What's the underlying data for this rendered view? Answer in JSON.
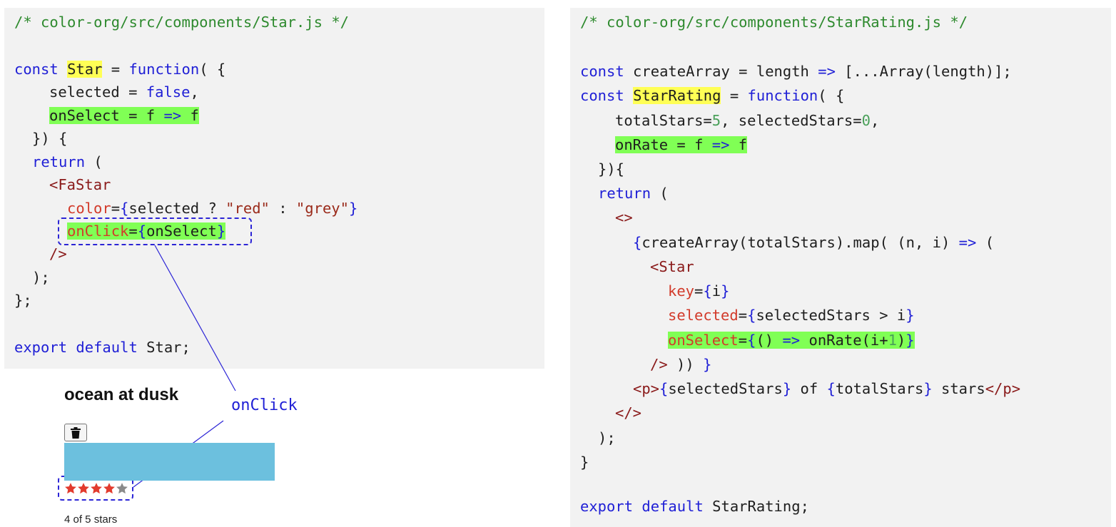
{
  "left_code": {
    "comment": "/* color-org/src/components/Star.js */",
    "l1": {
      "kw1": "const",
      "name": "Star",
      "eq": " = ",
      "kw2": "function",
      "rest": "( {"
    },
    "l2": {
      "name": "selected = ",
      "val": "false",
      "comma": ","
    },
    "l3": {
      "a": "onSelect = f ",
      "arrow": "=>",
      "b": " f"
    },
    "l4": "}) {",
    "l5": "return",
    "l5b": " (",
    "l6": "<FaStar",
    "l7": {
      "attr": "color",
      "eq": "=",
      "ob": "{",
      "expr": "selected ? ",
      "s1": "\"red\"",
      "colon": " : ",
      "s2": "\"grey\"",
      "cb": "}"
    },
    "l8": {
      "attr": "onClick",
      "eq": "=",
      "ob": "{",
      "expr": "onSelect",
      "cb": "}"
    },
    "l9": "/>",
    "l10": ");",
    "l11": "};",
    "l12": {
      "kw1": "export",
      "kw2": "default",
      "rest": " Star;"
    }
  },
  "right_code": {
    "comment": "/* color-org/src/components/StarRating.js */",
    "r1": {
      "kw": "const",
      "a": " createArray = length ",
      "arrow": "=>",
      "b": " [...Array(length)];"
    },
    "r2": {
      "kw1": "const",
      "name": "StarRating",
      "eq": " = ",
      "kw2": "function",
      "rest": "( {"
    },
    "r3": {
      "a": "totalStars=",
      "n1": "5",
      "b": ", selectedStars=",
      "n2": "0",
      "c": ","
    },
    "r4": {
      "a": "onRate = f ",
      "arrow": "=>",
      "b": " f"
    },
    "r5": "}){",
    "r6": "return",
    "r6b": " (",
    "r7": "<>",
    "r8": {
      "ob": "{",
      "a": "createArray(totalStars).map( (n, i) ",
      "arrow": "=>",
      "b": " ("
    },
    "r9": "<Star",
    "r10": {
      "attr": "key",
      "eq": "=",
      "ob": "{",
      "expr": "i",
      "cb": "}"
    },
    "r11": {
      "attr": "selected",
      "eq": "=",
      "ob": "{",
      "expr": "selectedStars > i",
      "cb": "}"
    },
    "r12": {
      "attr": "onSelect",
      "eq": "=",
      "ob": "{",
      "a": "() ",
      "arrow": "=>",
      "b": " onRate(i+",
      "n": "1",
      "c": ")",
      "cb": "}"
    },
    "r13": {
      "tag": "/>",
      "a": " )) ",
      "cb": "}"
    },
    "r14": {
      "open": "<p>",
      "ob1": "{",
      "a": "selectedStars",
      "cb1": "}",
      "b": " of ",
      "ob2": "{",
      "c": "totalStars",
      "cb2": "}",
      "d": " stars",
      "close": "</p>"
    },
    "r15": "</>",
    "r16": ");",
    "r17": "}",
    "r18": {
      "kw1": "export",
      "kw2": "default",
      "rest": " StarRating;"
    }
  },
  "demo": {
    "title": "ocean at dusk",
    "trash_icon": "trash-icon",
    "color": "#6cc0de",
    "rating": 4,
    "total": 5,
    "stars_text": "4 of 5 stars",
    "star_on": "#e23b2e",
    "star_off": "#8a8a8a"
  },
  "callout": {
    "label": "onClick"
  },
  "colors": {
    "accent": "#2c25d6",
    "highlight_yellow": "#ffff55",
    "highlight_green": "#80ff55",
    "panel_bg": "#f2f2f2"
  }
}
